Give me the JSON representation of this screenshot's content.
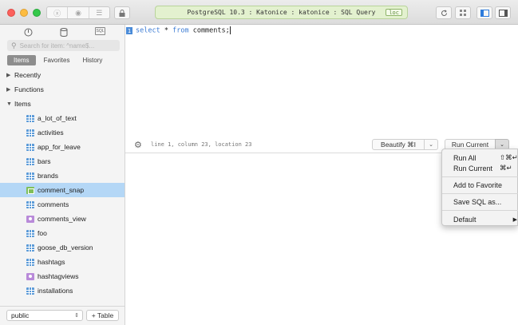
{
  "window": {
    "connection_title": "PostgreSQL 10.3 : Katonice : katonice : SQL Query",
    "connection_badge": "loc"
  },
  "toolbar": {
    "left_segment_icons": [
      "close-circle-icon",
      "eye-icon",
      "list-icon"
    ],
    "lock_icon": "lock-icon",
    "right_icons": [
      "refresh-icon",
      "grid-icon",
      "left-panel-icon",
      "right-panel-icon"
    ]
  },
  "sidebar": {
    "top_icons": [
      "power-icon",
      "database-icon",
      "sql-icon"
    ],
    "sql_label": "SQL",
    "search_placeholder": "Search for item: ^name$...",
    "tabs": [
      {
        "label": "Items",
        "active": true
      },
      {
        "label": "Favorites",
        "active": false
      },
      {
        "label": "History",
        "active": false
      }
    ],
    "groups": {
      "recently": "Recently",
      "functions": "Functions",
      "items": "Items"
    },
    "items": [
      {
        "label": "a_lot_of_text",
        "kind": "table"
      },
      {
        "label": "activities",
        "kind": "table"
      },
      {
        "label": "app_for_leave",
        "kind": "table"
      },
      {
        "label": "bars",
        "kind": "table"
      },
      {
        "label": "brands",
        "kind": "table"
      },
      {
        "label": "comment_snap",
        "kind": "snapshot",
        "selected": true
      },
      {
        "label": "comments",
        "kind": "table"
      },
      {
        "label": "comments_view",
        "kind": "view"
      },
      {
        "label": "foo",
        "kind": "table"
      },
      {
        "label": "goose_db_version",
        "kind": "table"
      },
      {
        "label": "hashtags",
        "kind": "table"
      },
      {
        "label": "hashtagviews",
        "kind": "view"
      },
      {
        "label": "installations",
        "kind": "table"
      }
    ],
    "schema": "public",
    "add_table_label": "+ Table"
  },
  "editor": {
    "line_number": "1",
    "kw_select": "select",
    "star": "*",
    "kw_from": "from",
    "rest": "comments;",
    "status": "line 1, column 23, location 23",
    "beautify_label": "Beautify ⌘I",
    "run_current_label": "Run Current"
  },
  "menu": {
    "run_all": "Run All",
    "run_all_shortcut": "⇧⌘↵",
    "run_current": "Run Current",
    "run_current_shortcut": "⌘↵",
    "add_favorite": "Add to Favorite",
    "save_sql": "Save SQL as...",
    "default": "Default",
    "default_submenu": "▶"
  },
  "colors": {
    "accent": "#4a8bd8",
    "selection": "#b4d7f6",
    "connection_bg": "#e3f1cf"
  }
}
